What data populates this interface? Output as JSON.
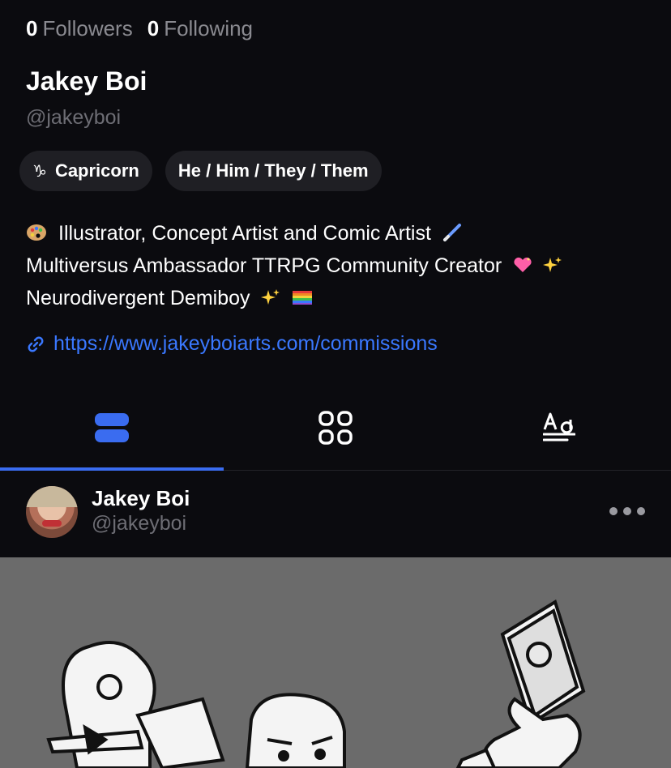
{
  "profile": {
    "followers_count": "0",
    "followers_label": "Followers",
    "following_count": "0",
    "following_label": "Following",
    "display_name": "Jakey Boi",
    "handle": "@jakeyboi",
    "zodiac_symbol": "♑",
    "zodiac": "Capricorn",
    "pronouns": "He / Him / They / Them",
    "bio_line1": "Illustrator, Concept Artist and Comic Artist",
    "bio_line2": "Multiversus Ambassador TTRPG Community Creator",
    "bio_line3": "Neurodivergent Demiboy",
    "link": "https://www.jakeyboiarts.com/commissions"
  },
  "tabs": [
    {
      "icon": "list-view-icon",
      "active": true
    },
    {
      "icon": "grid-view-icon",
      "active": false
    },
    {
      "icon": "text-view-icon",
      "active": false
    }
  ],
  "post": {
    "author_name": "Jakey Boi",
    "author_handle": "@jakeyboi"
  },
  "colors": {
    "background": "#0b0b0f",
    "accent": "#3a6cf0",
    "link": "#3a78ff",
    "muted": "#8a8a90",
    "chip": "#1f1f24"
  }
}
